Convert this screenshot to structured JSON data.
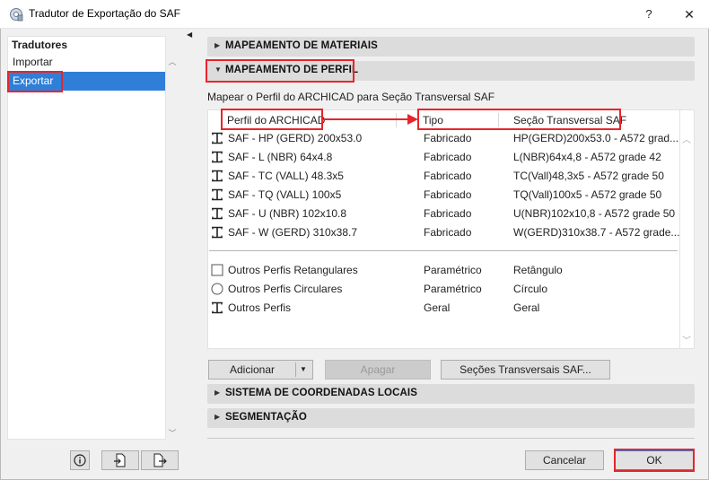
{
  "window": {
    "title": "Tradutor de Exportação do SAF",
    "help": "?",
    "close": "✕"
  },
  "sidebar": {
    "header": "Tradutores",
    "items": [
      {
        "label": "Importar",
        "selected": false
      },
      {
        "label": "Exportar",
        "selected": true
      }
    ]
  },
  "sections": {
    "materials": "MAPEAMENTO DE MATERIAIS",
    "profile": "MAPEAMENTO DE PERFIL",
    "coords": "SISTEMA DE COORDENADAS LOCAIS",
    "segmentation": "SEGMENTAÇÃO"
  },
  "profile": {
    "description": "Mapear o Perfil do ARCHICAD para Seção Transversal SAF",
    "columns": [
      "Perfil do ARCHICAD",
      "Tipo",
      "Seção Transversal SAF"
    ],
    "rows": [
      {
        "icon": "i-beam-icon",
        "name": "SAF - HP (GERD) 200x53.0",
        "type": "Fabricado",
        "section": "HP(GERD)200x53.0 - A572 grad..."
      },
      {
        "icon": "i-beam-icon",
        "name": "SAF - L (NBR) 64x4.8",
        "type": "Fabricado",
        "section": "L(NBR)64x4,8 - A572 grade 42"
      },
      {
        "icon": "i-beam-icon",
        "name": "SAF - TC (VALL) 48.3x5",
        "type": "Fabricado",
        "section": "TC(Vall)48,3x5 - A572 grade 50"
      },
      {
        "icon": "i-beam-icon",
        "name": "SAF - TQ (VALL) 100x5",
        "type": "Fabricado",
        "section": "TQ(Vall)100x5 - A572 grade 50"
      },
      {
        "icon": "i-beam-icon",
        "name": "SAF - U (NBR) 102x10.8",
        "type": "Fabricado",
        "section": "U(NBR)102x10,8 - A572 grade 50"
      },
      {
        "icon": "i-beam-icon",
        "name": "SAF - W (GERD) 310x38.7",
        "type": "Fabricado",
        "section": "W(GERD)310x38.7 - A572 grade..."
      }
    ],
    "other_rows": [
      {
        "icon": "square-icon",
        "name": "Outros Perfis Retangulares",
        "type": "Paramétrico",
        "section": "Retângulo"
      },
      {
        "icon": "circle-icon",
        "name": "Outros Perfis Circulares",
        "type": "Paramétrico",
        "section": "Círculo"
      },
      {
        "icon": "i-beam-icon",
        "name": "Outros Perfis",
        "type": "Geral",
        "section": "Geral"
      }
    ],
    "buttons": {
      "add": "Adicionar",
      "delete": "Apagar",
      "sections": "Seções Transversais SAF..."
    }
  },
  "footer": {
    "cancel": "Cancelar",
    "ok": "OK"
  },
  "colors": {
    "highlight": "#e8242c",
    "selection": "#2f7fd9"
  }
}
